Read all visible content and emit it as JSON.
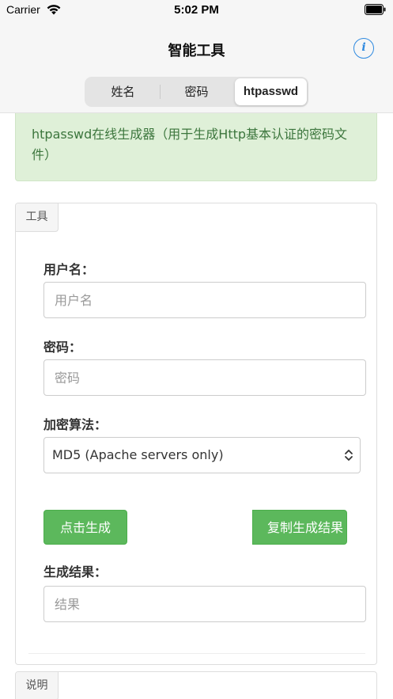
{
  "status_bar": {
    "carrier": "Carrier",
    "time": "5:02 PM"
  },
  "nav": {
    "title": "智能工具",
    "info_icon": "i"
  },
  "tabs": [
    {
      "label": "姓名",
      "selected": false
    },
    {
      "label": "密码",
      "selected": false
    },
    {
      "label": "htpasswd",
      "selected": true
    }
  ],
  "alert": {
    "text": "htpasswd在线生成器（用于生成Http基本认证的密码文件）"
  },
  "tool_panel": {
    "legend": "工具",
    "username": {
      "label": "用户名：",
      "placeholder": "用户名",
      "value": ""
    },
    "password": {
      "label": "密码：",
      "placeholder": "密码",
      "value": ""
    },
    "algorithm": {
      "label": "加密算法：",
      "selected": "MD5 (Apache servers only)"
    },
    "generate_button": "点击生成",
    "copy_button": "复制生成结果",
    "result": {
      "label": "生成结果：",
      "placeholder": "结果",
      "value": ""
    }
  },
  "info_panel": {
    "legend": "说明"
  },
  "colors": {
    "accent": "#2f8ae0",
    "success": "#5cb85c",
    "alert_bg": "#dff0d8",
    "alert_text": "#3c763d"
  }
}
